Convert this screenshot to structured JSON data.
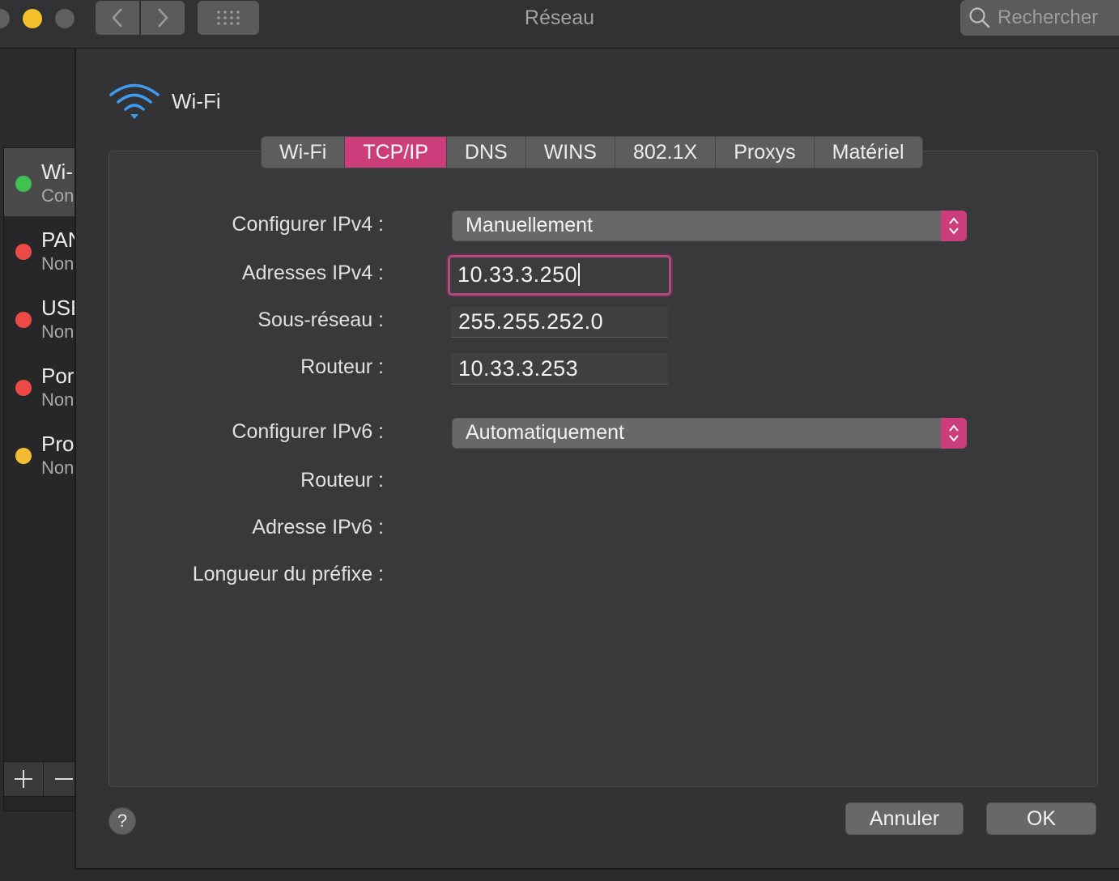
{
  "window": {
    "title": "Réseau",
    "search_placeholder": "Rechercher"
  },
  "sidebar": {
    "services": [
      {
        "name": "Wi-",
        "status": "Con",
        "dot_color": "#3fc250",
        "selected": true
      },
      {
        "name": "PAN",
        "status": "Non",
        "dot_color": "#ec4b45",
        "selected": false
      },
      {
        "name": "USE",
        "status": "Non",
        "dot_color": "#ec4b45",
        "selected": false
      },
      {
        "name": "Por",
        "status": "Non",
        "dot_color": "#ec4b45",
        "selected": false
      },
      {
        "name": "Pro",
        "status": "Non",
        "dot_color": "#f3bd33",
        "selected": false
      }
    ],
    "add_label": "+",
    "remove_label": "−"
  },
  "sheet": {
    "interface_label": "Wi-Fi",
    "tabs": [
      {
        "label": "Wi-Fi",
        "active": false
      },
      {
        "label": "TCP/IP",
        "active": true
      },
      {
        "label": "DNS",
        "active": false
      },
      {
        "label": "WINS",
        "active": false
      },
      {
        "label": "802.1X",
        "active": false
      },
      {
        "label": "Proxys",
        "active": false
      },
      {
        "label": "Matériel",
        "active": false
      }
    ],
    "ipv4": {
      "configure_label": "Configurer IPv4 :",
      "configure_value": "Manuellement",
      "address_label": "Adresses IPv4 :",
      "address_value": "10.33.3.250",
      "subnet_label": "Sous-réseau :",
      "subnet_value": "255.255.252.0",
      "router_label": "Routeur :",
      "router_value": "10.33.3.253"
    },
    "ipv6": {
      "configure_label": "Configurer IPv6 :",
      "configure_value": "Automatiquement",
      "router_label": "Routeur :",
      "address_label": "Adresse IPv6 :",
      "prefix_label": "Longueur du préfixe :"
    },
    "help_label": "?",
    "cancel_label": "Annuler",
    "ok_label": "OK"
  },
  "colors": {
    "accent": "#cc3e7b",
    "wifi_icon": "#3d9cf0"
  }
}
